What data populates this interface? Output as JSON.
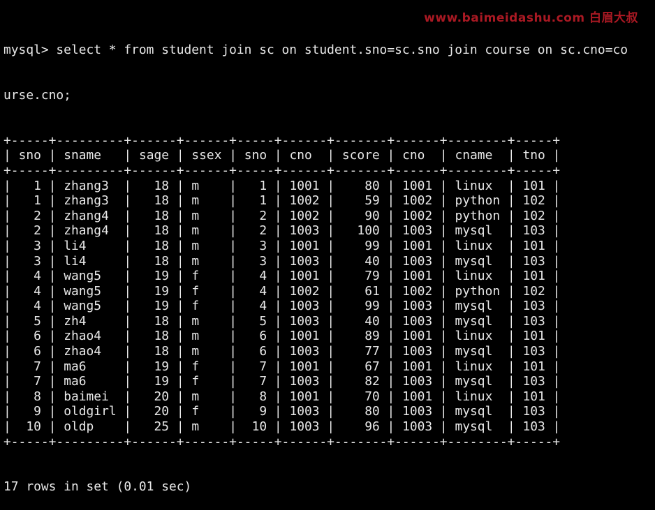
{
  "terminal": {
    "prompt": "mysql> ",
    "command": "select * from student join sc on student.sno=sc.sno join course on sc.cno=co",
    "command_continuation": "urse.cno;",
    "result_footer": "17 rows in set (0.01 sec)"
  },
  "watermark": {
    "text": "www.baimeidashu.com 白眉大叔",
    "color": "#c81e2a"
  },
  "table": {
    "columns": [
      {
        "label": "sno",
        "align": "right"
      },
      {
        "label": "sname",
        "align": "left"
      },
      {
        "label": "sage",
        "align": "right"
      },
      {
        "label": "ssex",
        "align": "left"
      },
      {
        "label": "sno",
        "align": "right"
      },
      {
        "label": "cno",
        "align": "right"
      },
      {
        "label": "score",
        "align": "right"
      },
      {
        "label": "cno",
        "align": "right"
      },
      {
        "label": "cname",
        "align": "left"
      },
      {
        "label": "tno",
        "align": "right"
      }
    ],
    "rows": [
      [
        "1",
        "zhang3",
        "18",
        "m",
        "1",
        "1001",
        "80",
        "1001",
        "linux",
        "101"
      ],
      [
        "1",
        "zhang3",
        "18",
        "m",
        "1",
        "1002",
        "59",
        "1002",
        "python",
        "102"
      ],
      [
        "2",
        "zhang4",
        "18",
        "m",
        "2",
        "1002",
        "90",
        "1002",
        "python",
        "102"
      ],
      [
        "2",
        "zhang4",
        "18",
        "m",
        "2",
        "1003",
        "100",
        "1003",
        "mysql",
        "103"
      ],
      [
        "3",
        "li4",
        "18",
        "m",
        "3",
        "1001",
        "99",
        "1001",
        "linux",
        "101"
      ],
      [
        "3",
        "li4",
        "18",
        "m",
        "3",
        "1003",
        "40",
        "1003",
        "mysql",
        "103"
      ],
      [
        "4",
        "wang5",
        "19",
        "f",
        "4",
        "1001",
        "79",
        "1001",
        "linux",
        "101"
      ],
      [
        "4",
        "wang5",
        "19",
        "f",
        "4",
        "1002",
        "61",
        "1002",
        "python",
        "102"
      ],
      [
        "4",
        "wang5",
        "19",
        "f",
        "4",
        "1003",
        "99",
        "1003",
        "mysql",
        "103"
      ],
      [
        "5",
        "zh4",
        "18",
        "m",
        "5",
        "1003",
        "40",
        "1003",
        "mysql",
        "103"
      ],
      [
        "6",
        "zhao4",
        "18",
        "m",
        "6",
        "1001",
        "89",
        "1001",
        "linux",
        "101"
      ],
      [
        "6",
        "zhao4",
        "18",
        "m",
        "6",
        "1003",
        "77",
        "1003",
        "mysql",
        "103"
      ],
      [
        "7",
        "ma6",
        "19",
        "f",
        "7",
        "1001",
        "67",
        "1001",
        "linux",
        "101"
      ],
      [
        "7",
        "ma6",
        "19",
        "f",
        "7",
        "1003",
        "82",
        "1003",
        "mysql",
        "103"
      ],
      [
        "8",
        "baimei",
        "20",
        "m",
        "8",
        "1001",
        "70",
        "1001",
        "linux",
        "101"
      ],
      [
        "9",
        "oldgirl",
        "20",
        "f",
        "9",
        "1003",
        "80",
        "1003",
        "mysql",
        "103"
      ],
      [
        "10",
        "oldp",
        "25",
        "m",
        "10",
        "1003",
        "96",
        "1003",
        "mysql",
        "103"
      ]
    ]
  },
  "colors": {
    "background": "#000000",
    "foreground": "#e8e8e8"
  }
}
